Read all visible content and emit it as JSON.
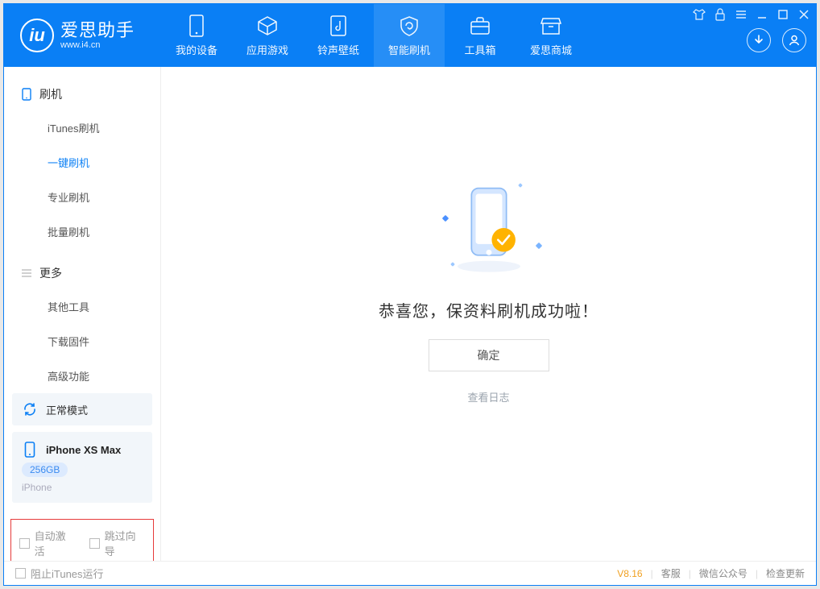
{
  "app": {
    "title": "爱思助手",
    "subtitle": "www.i4.cn"
  },
  "topTabs": {
    "device": "我的设备",
    "apps": "应用游戏",
    "ring": "铃声壁纸",
    "flash": "智能刷机",
    "tools": "工具箱",
    "store": "爱思商城"
  },
  "sidebar": {
    "group1": {
      "title": "刷机"
    },
    "items1": {
      "itunes": "iTunes刷机",
      "onekey": "一键刷机",
      "pro": "专业刷机",
      "batch": "批量刷机"
    },
    "group2": {
      "title": "更多"
    },
    "items2": {
      "other": "其他工具",
      "firmware": "下载固件",
      "advanced": "高级功能"
    }
  },
  "devicePanel": {
    "mode": "正常模式",
    "name": "iPhone XS Max",
    "capacity": "256GB",
    "type": "iPhone"
  },
  "options": {
    "autoActivate": "自动激活",
    "skipGuide": "跳过向导"
  },
  "main": {
    "successMsg": "恭喜您，保资料刷机成功啦！",
    "ok": "确定",
    "viewLog": "查看日志"
  },
  "statusbar": {
    "blockItunes": "阻止iTunes运行",
    "version": "V8.16",
    "service": "客服",
    "wechat": "微信公众号",
    "update": "检查更新"
  }
}
